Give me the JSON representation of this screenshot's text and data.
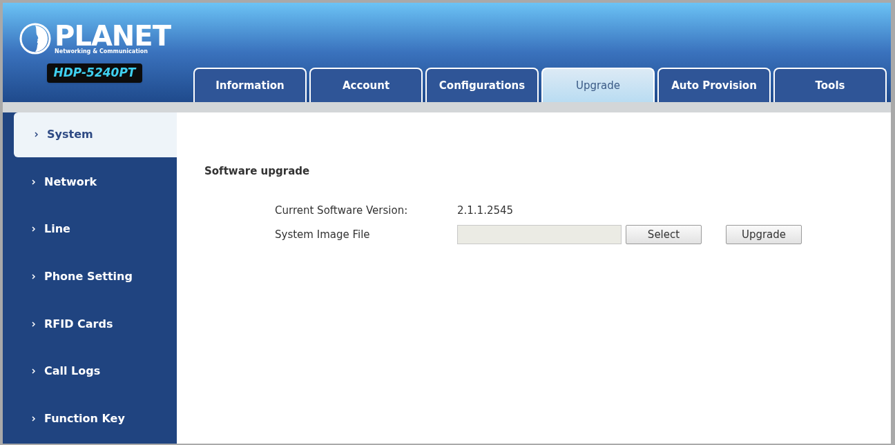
{
  "brand": {
    "name": "PLANET",
    "tagline": "Networking & Communication",
    "model": "HDP-5240PT"
  },
  "tabs": [
    {
      "label": "Information",
      "selected": false
    },
    {
      "label": "Account",
      "selected": false
    },
    {
      "label": "Configurations",
      "selected": false
    },
    {
      "label": "Upgrade",
      "selected": true
    },
    {
      "label": "Auto Provision",
      "selected": false
    },
    {
      "label": "Tools",
      "selected": false
    }
  ],
  "sidebar": {
    "items": [
      {
        "label": "System",
        "selected": true
      },
      {
        "label": "Network",
        "selected": false
      },
      {
        "label": "Line",
        "selected": false
      },
      {
        "label": "Phone Setting",
        "selected": false
      },
      {
        "label": "RFID Cards",
        "selected": false
      },
      {
        "label": "Call Logs",
        "selected": false
      },
      {
        "label": "Function Key",
        "selected": false
      }
    ]
  },
  "section": {
    "title": "Software upgrade",
    "version_label": "Current Software Version:",
    "version_value": "2.1.1.2545",
    "image_label": "System Image File",
    "select_button": "Select",
    "upgrade_button": "Upgrade"
  }
}
